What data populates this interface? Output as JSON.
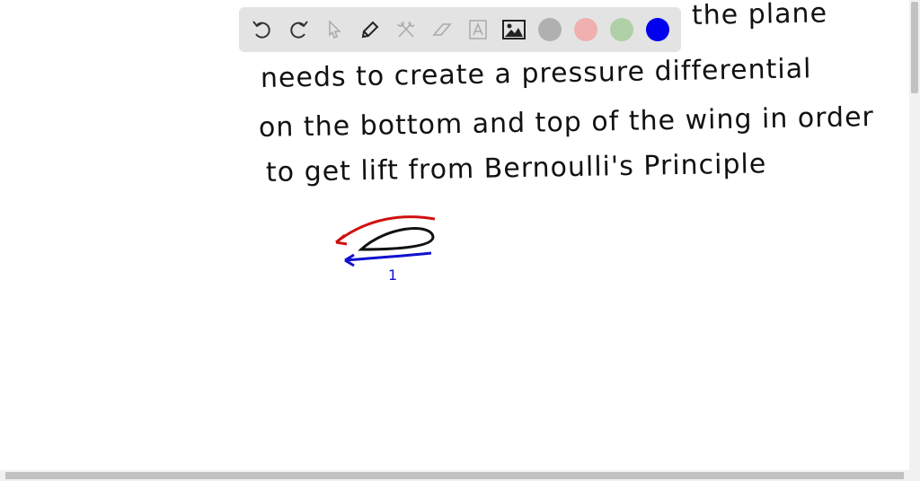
{
  "notes": {
    "line1": "the plane",
    "line2": "needs to create a pressure differential",
    "line3": "on the bottom and top of the wing in order",
    "line4": "to get lift from Bernoulli's Principle",
    "mark": "1"
  },
  "toolbar": {
    "tools": [
      "undo-icon",
      "redo-icon",
      "select-icon",
      "pen-icon",
      "tools-icon",
      "eraser-icon",
      "text-icon",
      "image-icon"
    ],
    "colors": [
      "#b0b0b0",
      "#f0b0b0",
      "#b0d0a8",
      "#0000ee"
    ],
    "selected_color": "#0000ee"
  },
  "drawing": {
    "upper_flow_color": "#d01010",
    "lower_flow_color": "#1010d0"
  }
}
